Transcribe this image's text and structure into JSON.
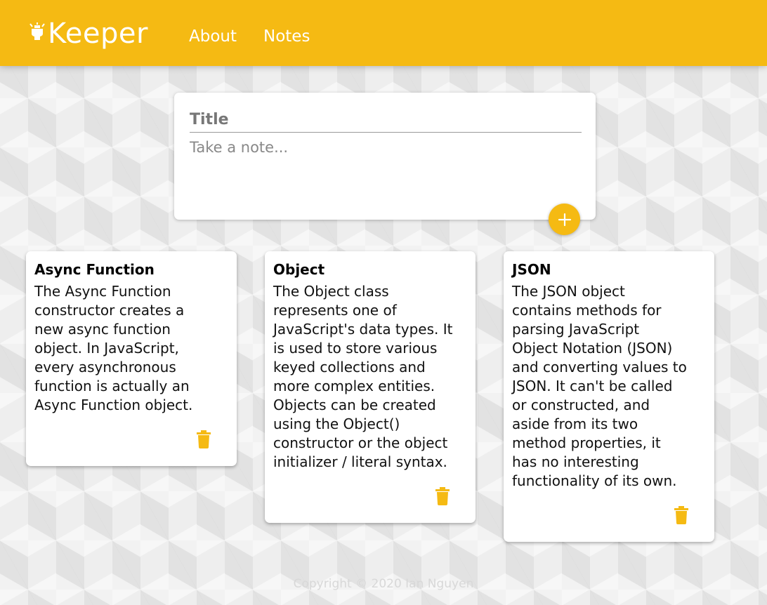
{
  "app": {
    "brand": "Keeper",
    "accent_color": "#f5ba13",
    "brand_icon": "lightbulb-icon"
  },
  "nav": {
    "items": [
      {
        "label": "About"
      },
      {
        "label": "Notes"
      }
    ]
  },
  "create_note": {
    "title_placeholder": "Title",
    "content_placeholder": "Take a note...",
    "add_icon": "plus-icon"
  },
  "notes": [
    {
      "title": "Async Function",
      "content": "The Async Function\nconstructor creates a\nnew async function\nobject. In JavaScript,\nevery asynchronous\nfunction is actually an\nAsync Function object.",
      "delete_icon": "trash-icon"
    },
    {
      "title": "Object",
      "content": "The Object class\nrepresents one of\nJavaScript's data types. It\nis used to store various\nkeyed collections and\nmore complex entities.\nObjects can be created\nusing the Object()\nconstructor or the object\ninitializer / literal syntax.",
      "delete_icon": "trash-icon"
    },
    {
      "title": "JSON",
      "content": "The JSON object\ncontains methods for\nparsing JavaScript\nObject Notation (JSON)\nand converting values to\nJSON. It can't be called\nor constructed, and\naside from its two\nmethod properties, it\nhas no interesting\nfunctionality of its own.",
      "delete_icon": "trash-icon"
    }
  ],
  "footer": {
    "text": "Copyright © 2020 Ian Nguyen"
  }
}
